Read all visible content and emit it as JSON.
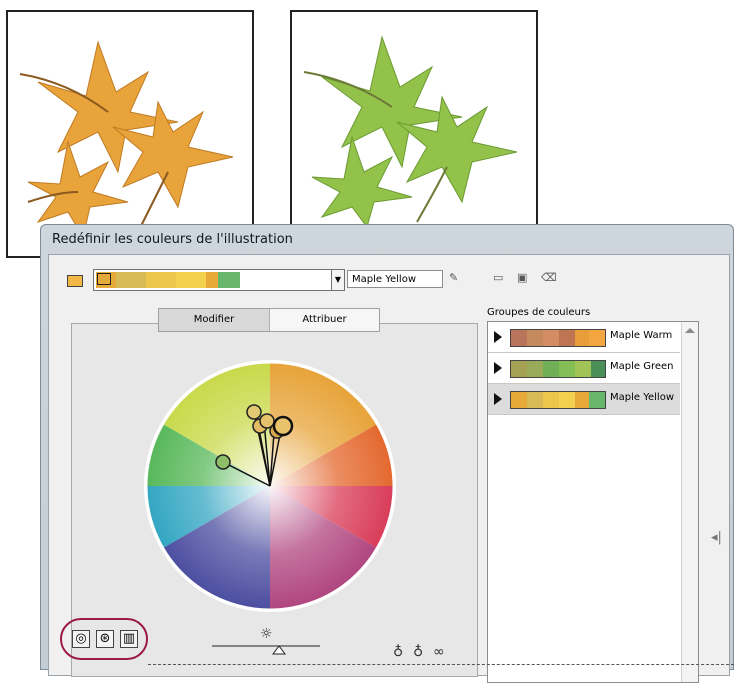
{
  "dialog": {
    "title": "Redéfinir les couleurs de l'illustration",
    "group_name": "Maple Yellow",
    "current_colors": [
      "#e6aa3a",
      "#d7ba55",
      "#ecc64a",
      "#f2d14e",
      "#e8a83a",
      "#68b66c"
    ]
  },
  "tabs": {
    "modify": "Modifier",
    "assign": "Attribuer"
  },
  "groups": {
    "label": "Groupes de couleurs",
    "items": [
      {
        "name": "Maple Warm",
        "colors": [
          "#b9745c",
          "#c48a5c",
          "#d38c64",
          "#c07552",
          "#e69d3a",
          "#f3a640"
        ],
        "selected": false
      },
      {
        "name": "Maple Green",
        "colors": [
          "#a4a054",
          "#99ab59",
          "#6faf56",
          "#83bf55",
          "#a1c356",
          "#4a8e58"
        ],
        "selected": false
      },
      {
        "name": "Maple Yellow",
        "colors": [
          "#e6aa3a",
          "#d7ba55",
          "#ecc64a",
          "#f2d14e",
          "#e8a83a",
          "#68b66c"
        ],
        "selected": true
      }
    ]
  },
  "icons": {
    "toolbar": [
      "save-icon",
      "new-group-icon",
      "delete-icon",
      "edit-swatch-icon"
    ],
    "bottom": [
      "smooth-wheel-icon",
      "segmented-wheel-icon",
      "color-bars-icon",
      "brightness-icon",
      "add-color-icon",
      "remove-color-icon",
      "link-harmony-icon"
    ]
  }
}
